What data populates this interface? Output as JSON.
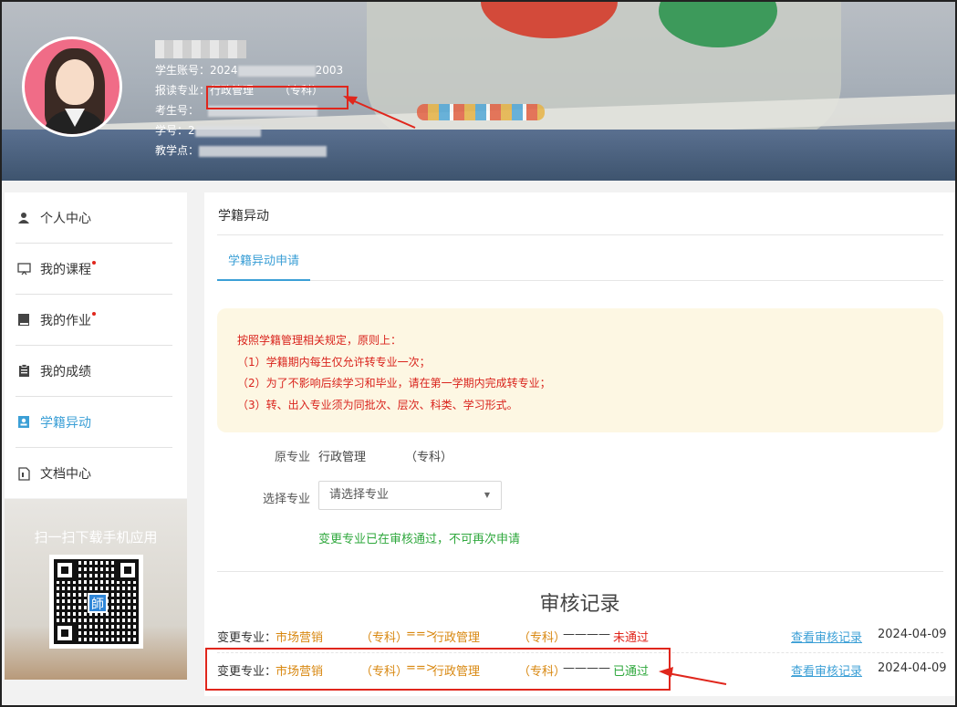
{
  "profile": {
    "account_label": "学生账号：",
    "account_value": "2024",
    "account_tail": "2003",
    "major_label": "报读专业：",
    "major_name": "行政管理",
    "major_level": "（专科）",
    "exam_no_label": "考生号：",
    "student_no_label": "学号：",
    "student_no_head": "2",
    "center_label": "教学点："
  },
  "sidebar": {
    "items": [
      {
        "label": "个人中心",
        "icon": "person-icon",
        "dot": false,
        "active": false
      },
      {
        "label": "我的课程",
        "icon": "monitor-icon",
        "dot": true,
        "active": false
      },
      {
        "label": "我的作业",
        "icon": "book-icon",
        "dot": true,
        "active": false
      },
      {
        "label": "我的成绩",
        "icon": "clipboard-icon",
        "dot": false,
        "active": false
      },
      {
        "label": "学籍异动",
        "icon": "id-card-icon",
        "dot": false,
        "active": true
      },
      {
        "label": "文档中心",
        "icon": "document-icon",
        "dot": false,
        "active": false
      }
    ],
    "qr_title": "扫一扫下载手机应用",
    "qr_logo": "師"
  },
  "main": {
    "title": "学籍异动",
    "tab_label": "学籍异动申请",
    "notice": [
      "按照学籍管理相关规定，原则上：",
      "（1）学籍期内每生仅允许转专业一次；",
      "（2）为了不影响后续学习和毕业，请在第一学期内完成转专业；",
      "（3）转、出入专业须为同批次、层次、科类、学习形式。"
    ],
    "original_major_label": "原专业",
    "original_major_name": "行政管理",
    "original_major_level": "（专科）",
    "select_major_label": "选择专业",
    "select_placeholder": "请选择专业",
    "success_note": "变更专业已在审核通过，不可再次申请",
    "records_title": "审核记录",
    "records": [
      {
        "prefix": "变更专业：",
        "from": "市场营销",
        "from_level": "（专科）",
        "arrow": "==>",
        "to": "行政管理",
        "to_level": "（专科）",
        "dash": "————",
        "status": "未通过",
        "status_type": "fail",
        "link": "查看审核记录",
        "date": "2024-04-09"
      },
      {
        "prefix": "变更专业：",
        "from": "市场营销",
        "from_level": "（专科）",
        "arrow": "==>",
        "to": "行政管理",
        "to_level": "（专科）",
        "dash": "————",
        "status": "已通过",
        "status_type": "pass",
        "link": "查看审核记录",
        "date": "2024-04-09"
      }
    ]
  },
  "colors": {
    "accent": "#3b9fd6",
    "highlight_box": "#e0261c",
    "notice_bg": "#fdf7e3",
    "pass": "#2fa83d",
    "fail": "#e0261c"
  }
}
